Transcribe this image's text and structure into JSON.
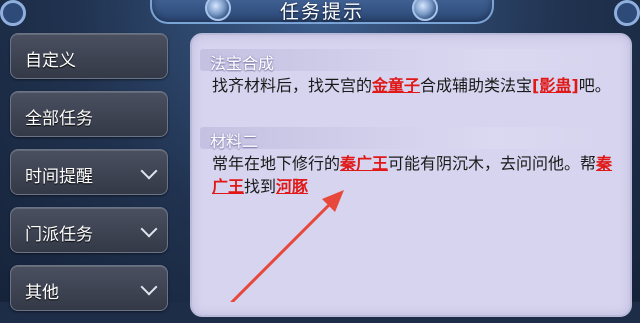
{
  "window": {
    "title": "任务提示"
  },
  "sidebar": {
    "items": [
      {
        "label": "自定义",
        "has_chevron": false
      },
      {
        "label": "全部任务",
        "has_chevron": false
      },
      {
        "label": "时间提醒",
        "has_chevron": true
      },
      {
        "label": "门派任务",
        "has_chevron": true
      },
      {
        "label": "其他",
        "has_chevron": true
      }
    ]
  },
  "content": {
    "sections": [
      {
        "heading": "法宝合成",
        "text_1": "找齐材料后，找天宫的",
        "link_1": "金童子",
        "text_2": "合成辅助类法宝",
        "link_2": "[影蛊]",
        "text_3": "吧。"
      },
      {
        "heading": "材料二",
        "text_1": "常年在地下修行的",
        "link_1": "秦广王",
        "text_2": "可能有阴沉木，去问问他。帮",
        "link_2": "秦广王",
        "text_3": "找到",
        "link_3": "河豚"
      }
    ]
  },
  "colors": {
    "highlight": "#e01818",
    "panel": "#d6d4ee",
    "arrow": "#e8483c"
  }
}
